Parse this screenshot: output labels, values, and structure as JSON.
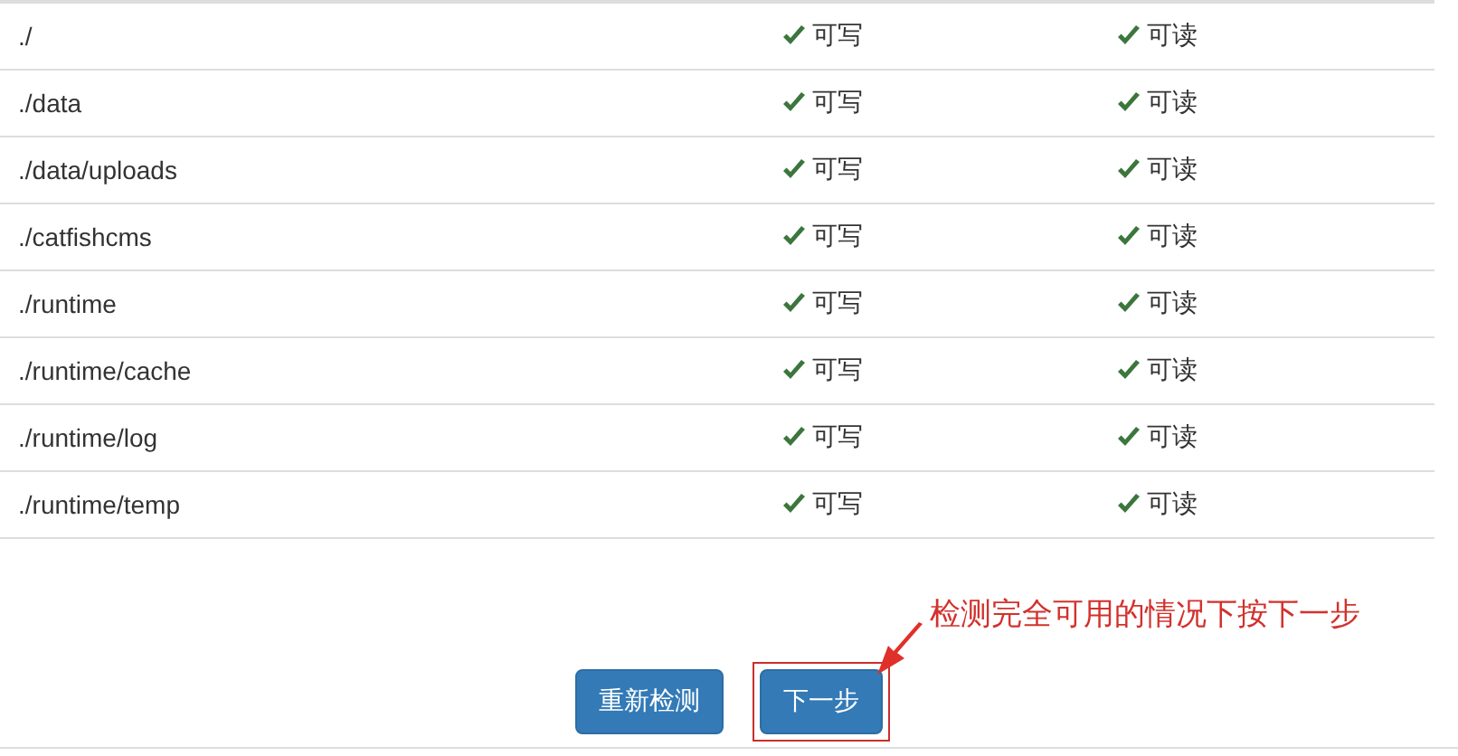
{
  "table": {
    "rows": [
      {
        "path": "./",
        "write": {
          "ok": true,
          "label": "可写"
        },
        "read": {
          "ok": true,
          "label": "可读"
        }
      },
      {
        "path": "./data",
        "write": {
          "ok": true,
          "label": "可写"
        },
        "read": {
          "ok": true,
          "label": "可读"
        }
      },
      {
        "path": "./data/uploads",
        "write": {
          "ok": true,
          "label": "可写"
        },
        "read": {
          "ok": true,
          "label": "可读"
        }
      },
      {
        "path": "./catfishcms",
        "write": {
          "ok": true,
          "label": "可写"
        },
        "read": {
          "ok": true,
          "label": "可读"
        }
      },
      {
        "path": "./runtime",
        "write": {
          "ok": true,
          "label": "可写"
        },
        "read": {
          "ok": true,
          "label": "可读"
        }
      },
      {
        "path": "./runtime/cache",
        "write": {
          "ok": true,
          "label": "可写"
        },
        "read": {
          "ok": true,
          "label": "可读"
        }
      },
      {
        "path": "./runtime/log",
        "write": {
          "ok": true,
          "label": "可写"
        },
        "read": {
          "ok": true,
          "label": "可读"
        }
      },
      {
        "path": "./runtime/temp",
        "write": {
          "ok": true,
          "label": "可写"
        },
        "read": {
          "ok": true,
          "label": "可读"
        }
      }
    ]
  },
  "buttons": [
    {
      "label": "重新检测",
      "highlighted": false
    },
    {
      "label": "下一步",
      "highlighted": true
    }
  ],
  "annotation": {
    "text": "检测完全可用的情况下按下一步"
  }
}
